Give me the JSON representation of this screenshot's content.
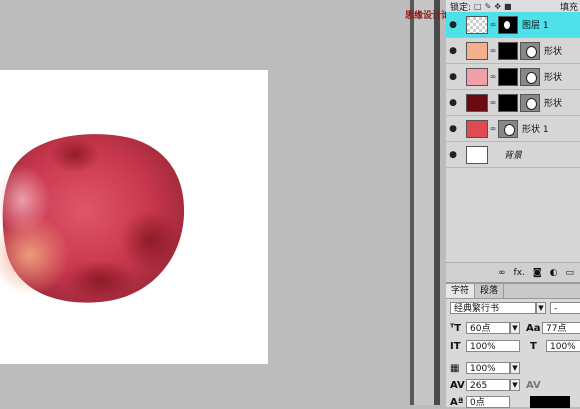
{
  "watermark": "思缘设计论坛 WWW.MISSYUAN.COM",
  "layers_panel": {
    "lock_label": "锁定:",
    "fill_label": "填充",
    "layers": [
      {
        "name": "图层 1",
        "active": true
      },
      {
        "name": "形状",
        "active": false
      },
      {
        "name": "形状",
        "active": false
      },
      {
        "name": "形状",
        "active": false
      },
      {
        "name": "形状 1",
        "active": false
      },
      {
        "name": "背景",
        "active": false
      }
    ],
    "bottom_icons": [
      "link-icon",
      "fx-icon",
      "mask-icon",
      "adjustment-icon",
      "folder-icon"
    ],
    "fx_label": "fx."
  },
  "character_panel": {
    "tab_character": "字符",
    "tab_paragraph": "段落",
    "font_family": "经典繁行书",
    "font_style": "-",
    "font_size": "60点",
    "leading": "77点",
    "vertical_scale": "100%",
    "horizontal_scale": "100%",
    "baseline_scale": "100%",
    "tracking": "265",
    "baseline_shift": "0点"
  },
  "colors": {
    "active_layer": "#4ee1ea",
    "swatch_peach": "#f4b08c",
    "swatch_pink": "#f2a0a8",
    "swatch_darkred": "#6b0a10",
    "swatch_red": "#e04a54"
  }
}
